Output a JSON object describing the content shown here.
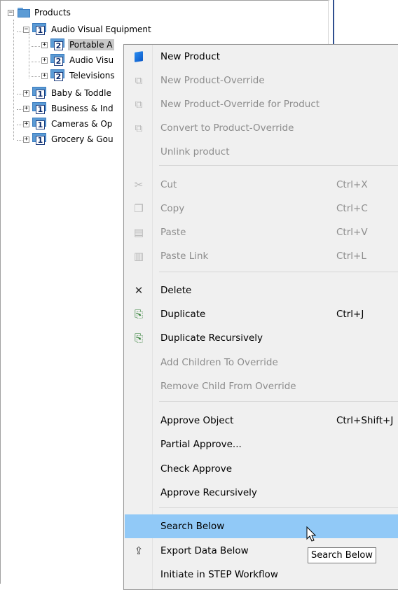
{
  "tree": {
    "root": {
      "label": "Products",
      "expander": "−"
    },
    "level1_open": {
      "label": "Audio Visual Equipment",
      "level": "1",
      "expander": "−"
    },
    "level2": [
      {
        "label": "Portable A",
        "level": "2",
        "expander": "+",
        "selected": true
      },
      {
        "label": "Audio Visu",
        "level": "2",
        "expander": "+"
      },
      {
        "label": "Televisions",
        "level": "2",
        "expander": "+"
      }
    ],
    "level1": [
      {
        "label": "Baby & Toddle",
        "level": "1",
        "expander": "+"
      },
      {
        "label": "Business & Ind",
        "level": "1",
        "expander": "+"
      },
      {
        "label": "Cameras & Op",
        "level": "1",
        "expander": "+"
      },
      {
        "label": "Grocery & Gou",
        "level": "1",
        "expander": "+"
      }
    ]
  },
  "menu": {
    "new_product": {
      "label": "New Product",
      "icon": "new-product-icon"
    },
    "new_product_override": {
      "label": "New Product-Override",
      "icon": "override-icon"
    },
    "new_product_override_for_product": {
      "label": "New Product-Override for Product",
      "icon": "override-icon"
    },
    "convert_to_override": {
      "label": "Convert to Product-Override",
      "icon": "override-icon"
    },
    "unlink_product": {
      "label": "Unlink product"
    },
    "cut": {
      "label": "Cut",
      "shortcut": "Ctrl+X",
      "icon": "scissors-icon"
    },
    "copy": {
      "label": "Copy",
      "shortcut": "Ctrl+C",
      "icon": "copy-icon"
    },
    "paste": {
      "label": "Paste",
      "shortcut": "Ctrl+V",
      "icon": "paste-icon"
    },
    "paste_link": {
      "label": "Paste Link",
      "shortcut": "Ctrl+L",
      "icon": "paste-link-icon"
    },
    "delete": {
      "label": "Delete",
      "icon": "delete-x-icon"
    },
    "duplicate": {
      "label": "Duplicate",
      "shortcut": "Ctrl+J",
      "icon": "duplicate-icon"
    },
    "duplicate_recursively": {
      "label": "Duplicate Recursively",
      "icon": "duplicate-icon"
    },
    "add_children_to_override": {
      "label": "Add Children To Override"
    },
    "remove_child_from_override": {
      "label": "Remove Child From Override"
    },
    "approve_object": {
      "label": "Approve Object",
      "shortcut": "Ctrl+Shift+J"
    },
    "partial_approve": {
      "label": "Partial Approve..."
    },
    "check_approve": {
      "label": "Check Approve"
    },
    "approve_recursively": {
      "label": "Approve Recursively"
    },
    "search_below": {
      "label": "Search Below"
    },
    "export_data_below": {
      "label": "Export Data Below",
      "icon": "export-icon"
    },
    "initiate_workflow": {
      "label": "Initiate in STEP Workflow"
    }
  },
  "tooltip": {
    "text": "Search Below"
  },
  "colors": {
    "menu_bg": "#f0f0f0",
    "highlight": "#91c9f7",
    "disabled_text": "#8d8d8d",
    "folder_blue": "#5b9bd5",
    "splitter": "#2f4f8f"
  }
}
